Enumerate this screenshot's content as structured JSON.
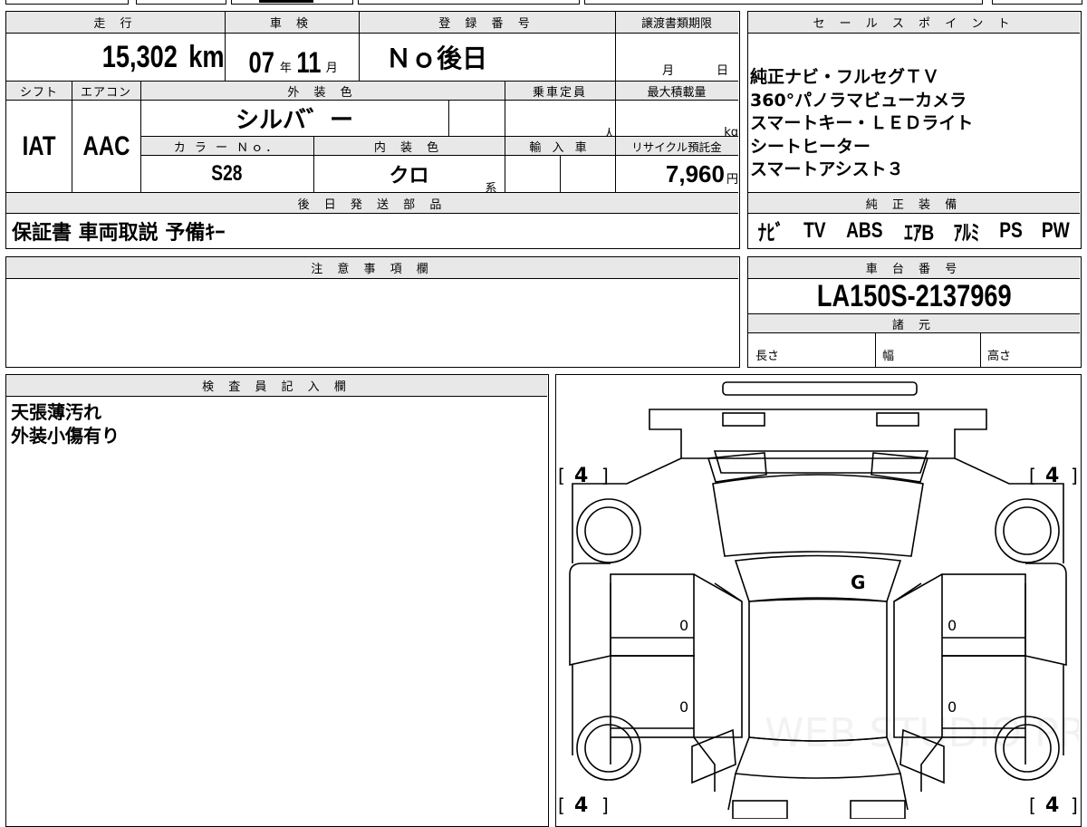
{
  "vehicle": {
    "mileage": {
      "label": "走 行",
      "value": "15,302",
      "unit": "km"
    },
    "inspection": {
      "label": "車 検",
      "year": "07",
      "year_unit": "年",
      "month": "11",
      "month_unit": "月"
    },
    "registration": {
      "label": "登 録 番 号",
      "value": "Ｎｏ後日"
    },
    "transfer": {
      "label": "譲渡書類期限",
      "month_unit": "月",
      "day_unit": "日"
    },
    "shift": {
      "label": "シフト",
      "value": "IAT"
    },
    "aircon": {
      "label": "エアコン",
      "value": "AAC"
    },
    "exterior_color": {
      "label": "外 装 色",
      "value": "シルバ゛ー"
    },
    "capacity": {
      "label": "乗車定員",
      "unit": "人"
    },
    "max_load": {
      "label": "最大積載量",
      "unit": "kg"
    },
    "color_no": {
      "label": "カ ラ ー Ｎｏ．",
      "value": "S28"
    },
    "interior_color": {
      "label": "内 装 色",
      "value": "クロ",
      "suffix": "系"
    },
    "import": {
      "label": "輸 入 車"
    },
    "recycle_fee": {
      "label": "リサイクル預託金",
      "value": "7,960",
      "unit": "円"
    },
    "later_parts": {
      "label": "後 日 発 送 部 品",
      "value": "保証書 車両取説 予備ｷｰ"
    }
  },
  "sales_points": {
    "label": "セ ー ル ス ポ イ ン ト",
    "lines": [
      "純正ナビ・フルセグＴＶ",
      "360°パノラマビューカメラ",
      "スマートキー・ＬＥＤライト",
      "シートヒーター",
      "スマートアシスト３"
    ]
  },
  "equipment": {
    "label": "純 正 装 備",
    "items": [
      "ﾅﾋﾞ",
      "TV",
      "ABS",
      "ｴｱB",
      "ｱﾙﾐ",
      "PS",
      "PW"
    ]
  },
  "notes": {
    "label": "注 意 事 項 欄"
  },
  "chassis": {
    "label": "車 台 番 号",
    "value": "LA150S-2137969"
  },
  "specs": {
    "label": "諸 元",
    "length": "長さ",
    "width": "幅",
    "height": "高さ"
  },
  "inspector": {
    "label": "検 査 員 記 入 欄",
    "lines": [
      "天張薄汚れ",
      "外装小傷有り"
    ]
  },
  "diagram": {
    "tires": {
      "front_left": "4",
      "front_right": "4",
      "rear_left": "4",
      "rear_right": "4"
    },
    "marks": {
      "glass": "G",
      "door_fl": "0",
      "door_fr": "0",
      "door_rl": "0",
      "door_rr": "0"
    },
    "watermark": "WEB STUDIO PRO"
  }
}
